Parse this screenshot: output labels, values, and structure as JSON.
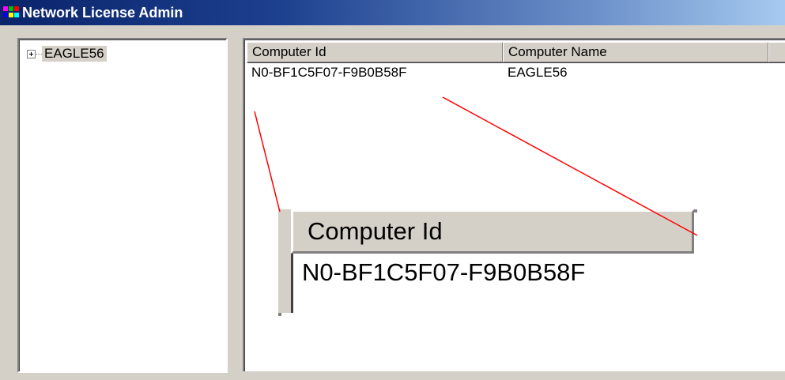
{
  "window": {
    "title": "Network License Admin",
    "icon": "app-icon"
  },
  "tree": {
    "items": [
      {
        "label": "EAGLE56",
        "expander": "plus-box-icon"
      }
    ]
  },
  "list": {
    "columns": [
      "Computer Id",
      "Computer Name",
      ""
    ],
    "rows": [
      {
        "computer_id": "N0-BF1C5F07-F9B0B58F",
        "computer_name": "EAGLE56"
      }
    ]
  },
  "zoom_callout": {
    "header": "Computer Id",
    "value": "N0-BF1C5F07-F9B0B58F",
    "line_color": "#ff0000"
  },
  "colors": {
    "titlebar_start": "#0a246a",
    "titlebar_end": "#a6caf0",
    "face": "#d4d0c8"
  }
}
